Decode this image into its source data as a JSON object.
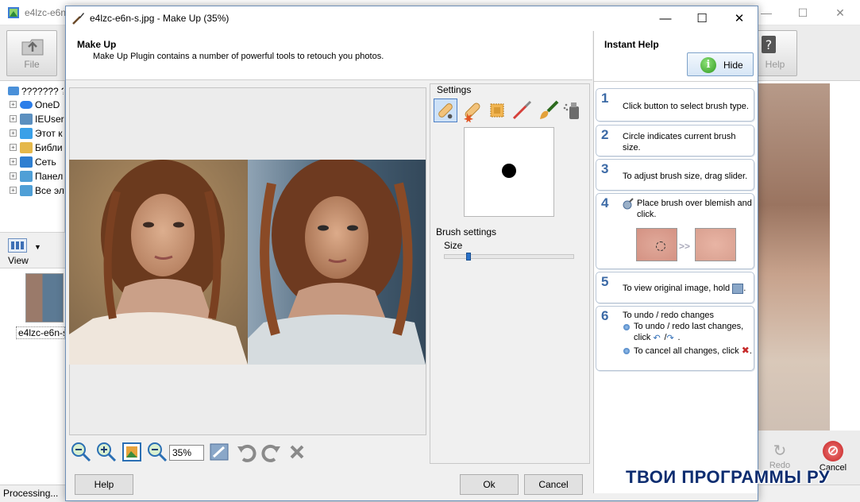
{
  "app": {
    "title": "e4lzc-e6n",
    "file_label": "File",
    "help_label": "Help",
    "view_label": "View",
    "status": "Processing...",
    "thumbnail_label": "e4lzc-e6n-s",
    "tree": [
      {
        "label": "??????? ??",
        "icon": "computer-icon"
      },
      {
        "label": "OneD",
        "icon": "cloud-icon"
      },
      {
        "label": "IEUser",
        "icon": "user-icon"
      },
      {
        "label": "Этот к",
        "icon": "pc-icon"
      },
      {
        "label": "Библи",
        "icon": "library-icon"
      },
      {
        "label": "Сеть",
        "icon": "network-icon"
      },
      {
        "label": "Панел",
        "icon": "control-panel-icon"
      },
      {
        "label": "Все эл",
        "icon": "control-panel-icon"
      }
    ],
    "redo_label": "Redo",
    "cancel_label": "Cancel"
  },
  "dialog": {
    "title": "e4lzc-e6n-s.jpg - Make Up (35%)",
    "header_title": "Make Up",
    "header_desc": "Make Up Plugin contains a number of powerful tools to retouch you photos.",
    "settings_label": "Settings",
    "tools": [
      "bandage-icon",
      "bandage-spark-icon",
      "patch-icon",
      "brush-icon",
      "makeup-brush-icon",
      "spray-icon"
    ],
    "brush_settings_label": "Brush settings",
    "size_label": "Size",
    "brush_size": 0.18,
    "zoom_value": "35%",
    "buttons": {
      "help": "Help",
      "ok": "Ok",
      "cancel": "Cancel"
    }
  },
  "instant_help": {
    "title": "Instant Help",
    "hide_label": "Hide",
    "steps": [
      {
        "num": "1",
        "text": "Click button to select brush type."
      },
      {
        "num": "2",
        "text": "Circle indicates current brush size."
      },
      {
        "num": "3",
        "text": "To adjust brush size, drag slider."
      },
      {
        "num": "4",
        "text": "Place brush over blemish and click.",
        "arrow": ">>"
      },
      {
        "num": "5",
        "text": "To view original image, hold",
        "suffix": "."
      },
      {
        "num": "6",
        "text": "To undo / redo changes",
        "bullet1": "To undo / redo last changes, click",
        "bullet1_mid": "/",
        "bullet1_end": ".",
        "bullet2": "To cancel all changes, click",
        "bullet2_end": "."
      }
    ]
  },
  "watermark": "ТВОИ ПРОГРАММЫ РУ"
}
